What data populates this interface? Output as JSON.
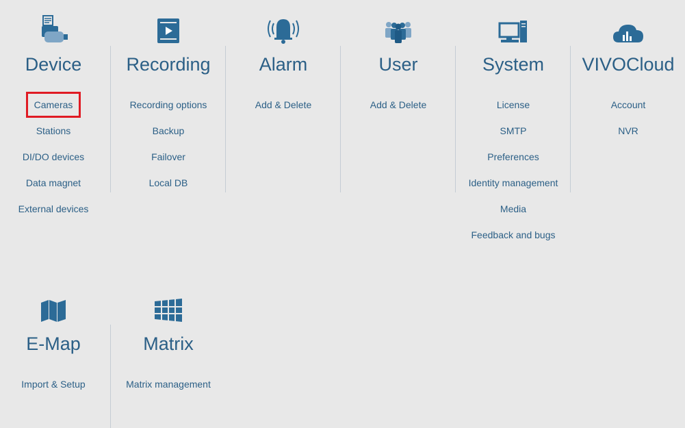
{
  "colors": {
    "accent": "#2b5f86",
    "icon": "#2c6b97",
    "selection": "#e01b24",
    "background": "#e8e8e8"
  },
  "sections": [
    {
      "title": "Device",
      "icon": "device-icon",
      "items": [
        "Cameras",
        "Stations",
        "DI/DO devices",
        "Data magnet",
        "External devices"
      ],
      "selected_item": "Cameras"
    },
    {
      "title": "Recording",
      "icon": "recording-icon",
      "items": [
        "Recording options",
        "Backup",
        "Failover",
        "Local DB"
      ]
    },
    {
      "title": "Alarm",
      "icon": "alarm-bell-icon",
      "items": [
        "Add & Delete"
      ]
    },
    {
      "title": "User",
      "icon": "users-icon",
      "items": [
        "Add & Delete"
      ]
    },
    {
      "title": "System",
      "icon": "computer-icon",
      "items": [
        "License",
        "SMTP",
        "Preferences",
        "Identity management",
        "Media",
        "Feedback and bugs"
      ]
    },
    {
      "title": "VIVOCloud",
      "icon": "cloud-icon",
      "items": [
        "Account",
        "NVR"
      ]
    },
    {
      "title": "E-Map",
      "icon": "map-icon",
      "items": [
        "Import & Setup"
      ]
    },
    {
      "title": "Matrix",
      "icon": "matrix-grid-icon",
      "items": [
        "Matrix management"
      ]
    }
  ]
}
